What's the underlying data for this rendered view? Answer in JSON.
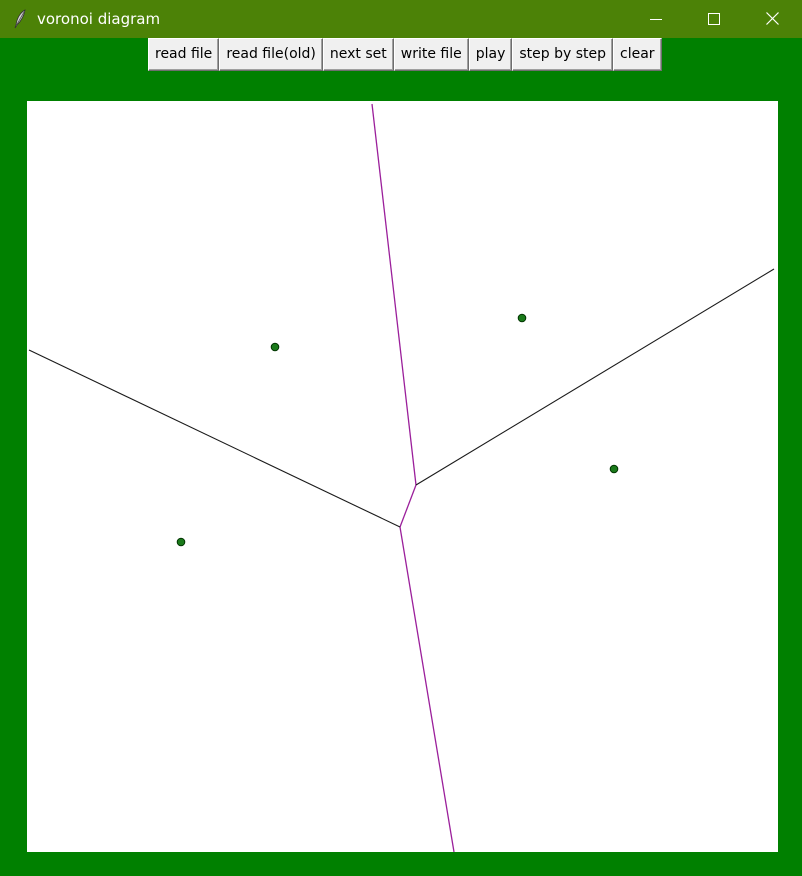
{
  "window": {
    "title": "voronoi diagram",
    "icon": "feather-icon",
    "controls": [
      "minimize-icon",
      "maximize-icon",
      "close-icon"
    ]
  },
  "toolbar": {
    "buttons": [
      {
        "label": "read file"
      },
      {
        "label": "read file(old)"
      },
      {
        "label": "next set"
      },
      {
        "label": "write file"
      },
      {
        "label": "play"
      },
      {
        "label": "step by step"
      },
      {
        "label": "clear"
      }
    ]
  },
  "colors": {
    "window_background": "#008000",
    "titlebar": "#4c8207",
    "canvas": "#ffffff",
    "site_fill": "#1a7a1a",
    "site_stroke": "#003300",
    "perpendicular_edge": "#9b1f9b",
    "hyperplane_edge": "#1a1a1a"
  }
}
